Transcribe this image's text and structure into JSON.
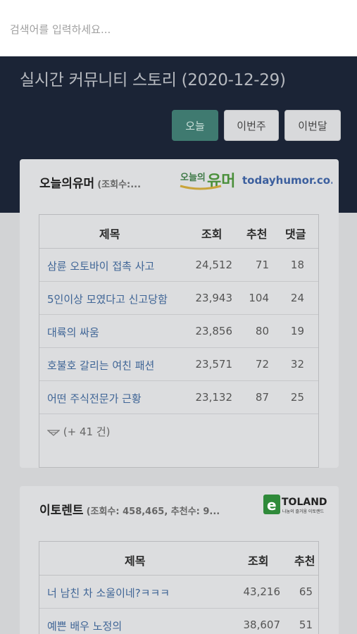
{
  "search": {
    "placeholder": "검색어를 입력하세요..."
  },
  "header": {
    "title": "실시간 커뮤니티 스토리 (2020-12-29)"
  },
  "tabs": [
    {
      "label": "오늘",
      "active": true
    },
    {
      "label": "이번주",
      "active": false
    },
    {
      "label": "이번달",
      "active": false
    }
  ],
  "cards": [
    {
      "title": "오늘의유머",
      "stats": "(조회수:...",
      "logo": {
        "text_main": "오늘의유머",
        "text_domain": "todayhumor.co.kr"
      },
      "columns": [
        "제목",
        "조회",
        "추천",
        "댓글"
      ],
      "rows": [
        {
          "title": "삼륜 오토바이 접촉 사고",
          "views": "24,512",
          "rec": "71",
          "comments": "18"
        },
        {
          "title": "5인이상 모였다고 신고당함",
          "views": "23,943",
          "rec": "104",
          "comments": "24"
        },
        {
          "title": "대륙의 싸움",
          "views": "23,856",
          "rec": "80",
          "comments": "19"
        },
        {
          "title": "호불호 갈리는 여친 패션",
          "views": "23,571",
          "rec": "72",
          "comments": "32"
        },
        {
          "title": "어떤 주식전문가 근황",
          "views": "23,132",
          "rec": "87",
          "comments": "25"
        }
      ],
      "more": "(+ 41 건)"
    },
    {
      "title": "이토렌트",
      "stats": "(조회수: 458,465, 추천수: 9...",
      "logo": {
        "text_main": "eTOLAND",
        "text_sub": "나눔의 즐거움 이토랜드"
      },
      "columns": [
        "제목",
        "조회",
        "추천"
      ],
      "rows": [
        {
          "title": "너 남친 차 소울이네?ㅋㅋㅋ",
          "views": "43,216",
          "rec": "65"
        },
        {
          "title": "예쁜 배우 노정의",
          "views": "38,607",
          "rec": "51"
        }
      ]
    }
  ],
  "colors": {
    "header_bg": "#1b2436",
    "active_tab": "#3f7a70",
    "link": "#3f6596"
  }
}
